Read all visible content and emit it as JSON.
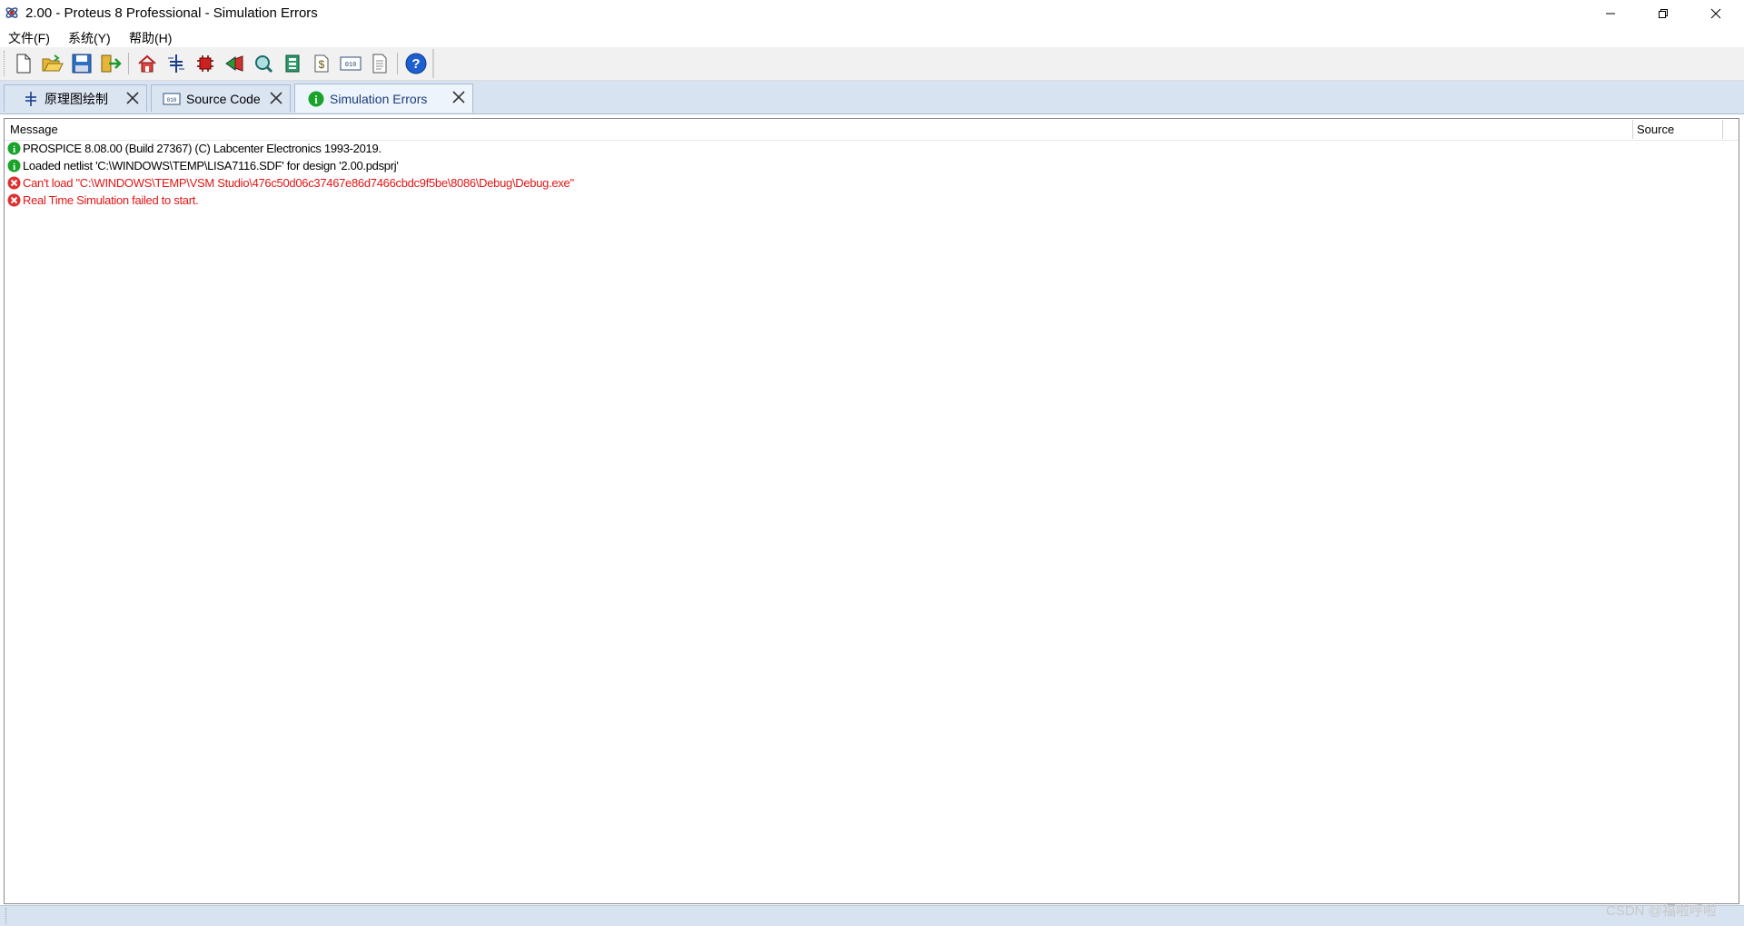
{
  "window": {
    "title": "2.00 - Proteus 8 Professional - Simulation Errors",
    "icon": "proteus-app-icon"
  },
  "menu": {
    "items": [
      {
        "label": "文件(F)"
      },
      {
        "label": "系统(Y)"
      },
      {
        "label": "帮助(H)"
      }
    ]
  },
  "toolbar": {
    "buttons": [
      "new-file-icon",
      "open-folder-icon",
      "save-icon",
      "import-export-icon",
      "home-icon",
      "schematic-icon",
      "pcb-icon",
      "gerber-icon",
      "3d-viewer-icon",
      "bom-icon",
      "dollar-icon",
      "source-code-icon",
      "notes-icon",
      "help-icon"
    ]
  },
  "tabs": [
    {
      "label": "原理图绘制",
      "icon": "schematic-tab-icon",
      "active": false
    },
    {
      "label": "Source Code",
      "icon": "source-code-tab-icon",
      "active": false
    },
    {
      "label": "Simulation Errors",
      "icon": "info-tab-icon",
      "active": true
    }
  ],
  "table": {
    "columns": [
      "Message",
      "Source"
    ],
    "rows": [
      {
        "type": "info",
        "message": "PROSPICE 8.08.00 (Build 27367) (C) Labcenter Electronics 1993-2019.",
        "source": ""
      },
      {
        "type": "info",
        "message": "Loaded netlist 'C:\\WINDOWS\\TEMP\\LISA7116.SDF' for design '2.00.pdsprj'",
        "source": ""
      },
      {
        "type": "error",
        "message": "Can't load \"C:\\WINDOWS\\TEMP\\VSM Studio\\476c50d06c37467e86d7466cbdc9f5be\\8086\\Debug\\Debug.exe\"",
        "source": ""
      },
      {
        "type": "error",
        "message": "Real Time Simulation failed to start.",
        "source": ""
      }
    ]
  },
  "colors": {
    "error_text": "#e31515",
    "info_icon": "#1aa32a",
    "error_icon": "#e03030",
    "tabstrip_bg": "#d7e3f1"
  },
  "watermark": "CSDN @福啦呼啦"
}
